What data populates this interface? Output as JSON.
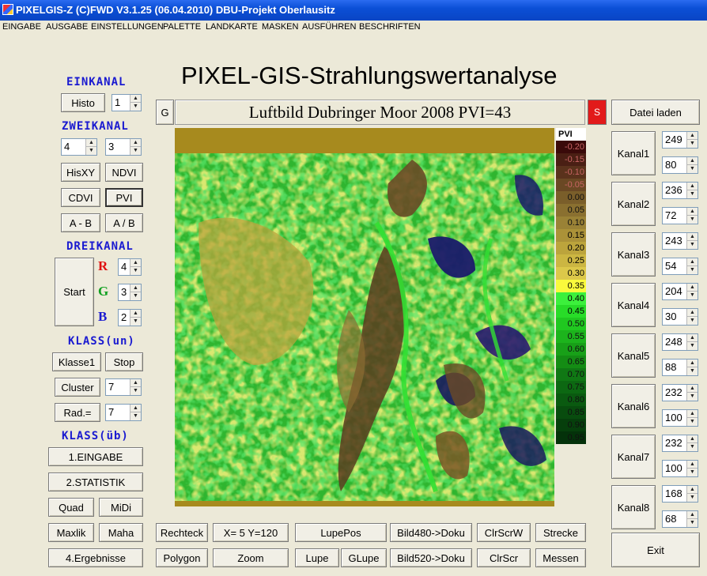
{
  "window": {
    "title": "PIXELGIS-Z (C)FWD V3.1.25 (06.04.2010)  DBU-Projekt Oberlausitz"
  },
  "menu": [
    "EINGABE",
    "AUSGABE",
    "EINSTELLUNGEN",
    "PALETTE",
    "LANDKARTE",
    "MASKEN",
    "AUSFÜHREN",
    "BESCHRIFTEN"
  ],
  "main_title": "PIXEL-GIS-Strahlungswertanalyse",
  "image_title": "Luftbild Dubringer Moor 2008 PVI=43",
  "g_label": "G",
  "s_label": "S",
  "colors": {
    "accent_red": "#e21a1a",
    "heading_blue": "#1a1ad0",
    "window_bg": "#ece9d8"
  },
  "einkanal": {
    "heading": "EINKANAL",
    "histo": "Histo",
    "channel": "1"
  },
  "zweikanal": {
    "heading": "ZWEIKANAL",
    "channel_a": "4",
    "channel_b": "3",
    "hisxy": "HisXY",
    "ndvi": "NDVI",
    "cdvi": "CDVI",
    "pvi": "PVI",
    "a_minus_b": "A - B",
    "a_div_b": "A / B"
  },
  "dreikanal": {
    "heading": "DREIKANAL",
    "start": "Start",
    "r_label": "R",
    "g_label": "G",
    "b_label": "B",
    "r_value": "4",
    "g_value": "3",
    "b_value": "2"
  },
  "klass_un": {
    "heading": "KLASS(un)",
    "klasse1": "Klasse1",
    "stop": "Stop",
    "cluster": "Cluster",
    "cluster_value": "7",
    "rad": "Rad.=",
    "rad_value": "7"
  },
  "klass_ub": {
    "heading": "KLASS(üb)",
    "eingabe": "1.EINGABE",
    "statistik": "2.STATISTIK",
    "quad": "Quad",
    "midi": "MiDi",
    "maxlik": "Maxlik",
    "maha": "Maha",
    "ergebnisse": "4.Ergebnisse"
  },
  "bottom": {
    "rechteck": "Rechteck",
    "coords": "X=  5 Y=120",
    "lupepos": "LupePos",
    "bild480": "Bild480->Doku",
    "clrscrw": "ClrScrW",
    "strecke": "Strecke",
    "polygon": "Polygon",
    "zoom": "Zoom",
    "lupe": "Lupe",
    "glupe": "GLupe",
    "bild520": "Bild520->Doku",
    "clrscr": "ClrScr",
    "messen": "Messen"
  },
  "right": {
    "datei_laden": "Datei laden",
    "exit": "Exit",
    "kanaele": [
      {
        "label": "Kanal1",
        "v1": "249",
        "v2": "80"
      },
      {
        "label": "Kanal2",
        "v1": "236",
        "v2": "72"
      },
      {
        "label": "Kanal3",
        "v1": "243",
        "v2": "54"
      },
      {
        "label": "Kanal4",
        "v1": "204",
        "v2": "30"
      },
      {
        "label": "Kanal5",
        "v1": "248",
        "v2": "88"
      },
      {
        "label": "Kanal6",
        "v1": "232",
        "v2": "100"
      },
      {
        "label": "Kanal7",
        "v1": "232",
        "v2": "100"
      },
      {
        "label": "Kanal8",
        "v1": "168",
        "v2": "68"
      }
    ]
  },
  "legend": {
    "title": "PVI",
    "entries": [
      {
        "label": "-0.20",
        "color": "#3a0a0a"
      },
      {
        "label": "-0.15",
        "color": "#4a1f14"
      },
      {
        "label": "-0.10",
        "color": "#5a321c"
      },
      {
        "label": "-0.05",
        "color": "#6a4824"
      },
      {
        "label": "0.00",
        "color": "#7a5e2a"
      },
      {
        "label": "0.05",
        "color": "#8a7030"
      },
      {
        "label": "0.10",
        "color": "#9a8236"
      },
      {
        "label": "0.15",
        "color": "#ab9238"
      },
      {
        "label": "0.20",
        "color": "#bca43c"
      },
      {
        "label": "0.25",
        "color": "#ccb642"
      },
      {
        "label": "0.30",
        "color": "#dcc84a"
      },
      {
        "label": "0.35",
        "color": "#fafa3c"
      },
      {
        "label": "0.40",
        "color": "#3cf03c"
      },
      {
        "label": "0.45",
        "color": "#28dc28"
      },
      {
        "label": "0.50",
        "color": "#20c820"
      },
      {
        "label": "0.55",
        "color": "#1cb41c"
      },
      {
        "label": "0.60",
        "color": "#18a018"
      },
      {
        "label": "0.65",
        "color": "#148c14"
      },
      {
        "label": "0.70",
        "color": "#107814"
      },
      {
        "label": "0.75",
        "color": "#0c6812"
      },
      {
        "label": "0.80",
        "color": "#0a5a10"
      },
      {
        "label": "0.85",
        "color": "#084c0e"
      },
      {
        "label": "0.90",
        "color": "#063f0c"
      },
      {
        "label": "0.95",
        "color": "#04320a"
      }
    ]
  }
}
